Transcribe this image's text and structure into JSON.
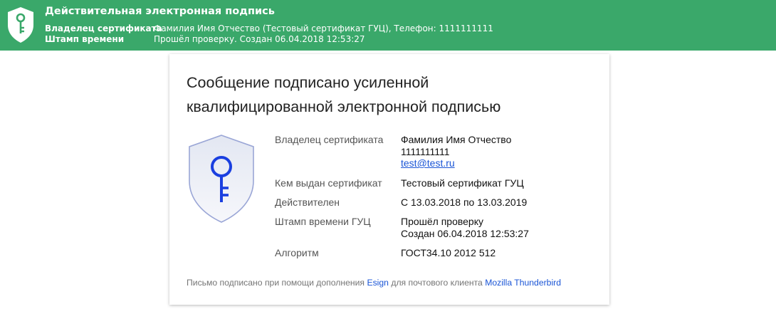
{
  "colors": {
    "banner_bg": "#3aa86a",
    "link": "#1a55d6",
    "key_icon": "#1a3fe0"
  },
  "banner": {
    "icon": "shield-key-icon",
    "title": "Действительная электронная подпись",
    "rows": [
      {
        "label": "Владелец сертификата",
        "value": "Фамилия Имя Отчество (Тестовый сертификат ГУЦ), Телефон: 1111111111"
      },
      {
        "label": "Штамп времени",
        "value": "Прошёл проверку. Создан 06.04.2018 12:53:27"
      }
    ]
  },
  "card": {
    "heading_line1": "Сообщение подписано усиленной",
    "heading_line2": "квалифицированной электронной подписью",
    "icon": "shield-key-icon",
    "details": {
      "owner": {
        "label": "Владелец сертификата",
        "name": "Фамилия Имя Отчество",
        "phone": "1111111111",
        "email": "test@test.ru"
      },
      "issuer": {
        "label": "Кем выдан сертификат",
        "value": "Тестовый сертификат ГУЦ"
      },
      "valid": {
        "label": "Действителен",
        "value": "С 13.03.2018 по 13.03.2019"
      },
      "timestamp": {
        "label": "Штамп времени ГУЦ",
        "line1": "Прошёл проверку",
        "line2": "Создан 06.04.2018 12:53:27"
      },
      "algorithm": {
        "label": "Алгоритм",
        "value": "ГОСТ34.10 2012 512"
      }
    },
    "footer": {
      "prefix": "Письмо подписано при помощи дополнения",
      "addon_link": "Esign",
      "middle": "для почтового клиента",
      "client_link": "Mozilla Thunderbird"
    }
  }
}
